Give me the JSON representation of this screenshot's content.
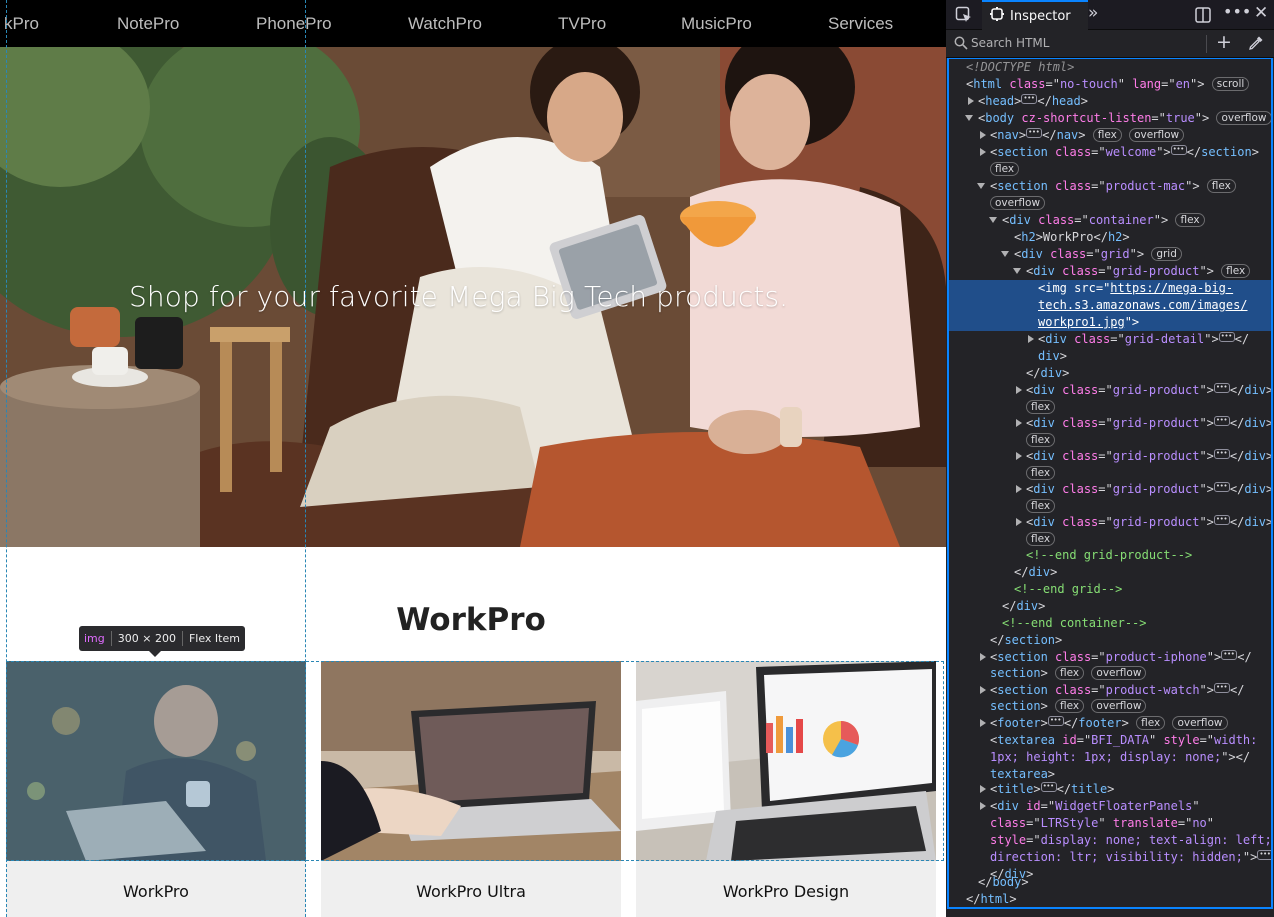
{
  "page": {
    "nav_links": [
      "kPro",
      "NotePro",
      "PhonePro",
      "WatchPro",
      "TVPro",
      "MusicPro",
      "Services"
    ],
    "hero_heading": "Shop for your favorite Mega Big Tech products.",
    "section_title": "WorkPro",
    "products": [
      "WorkPro",
      "WorkPro Ultra",
      "WorkPro Design"
    ]
  },
  "tooltip": {
    "tag": "img",
    "size": "300 × 200",
    "kind": "Flex Item"
  },
  "devtools": {
    "tab_label": "Inspector",
    "search_placeholder": "Search HTML"
  },
  "colors": {
    "accent": "#0a84ff",
    "selection": "#204e8a",
    "tag": "#75bfff",
    "attr": "#ff7de9",
    "value": "#b98eff",
    "comment": "#86de74"
  }
}
